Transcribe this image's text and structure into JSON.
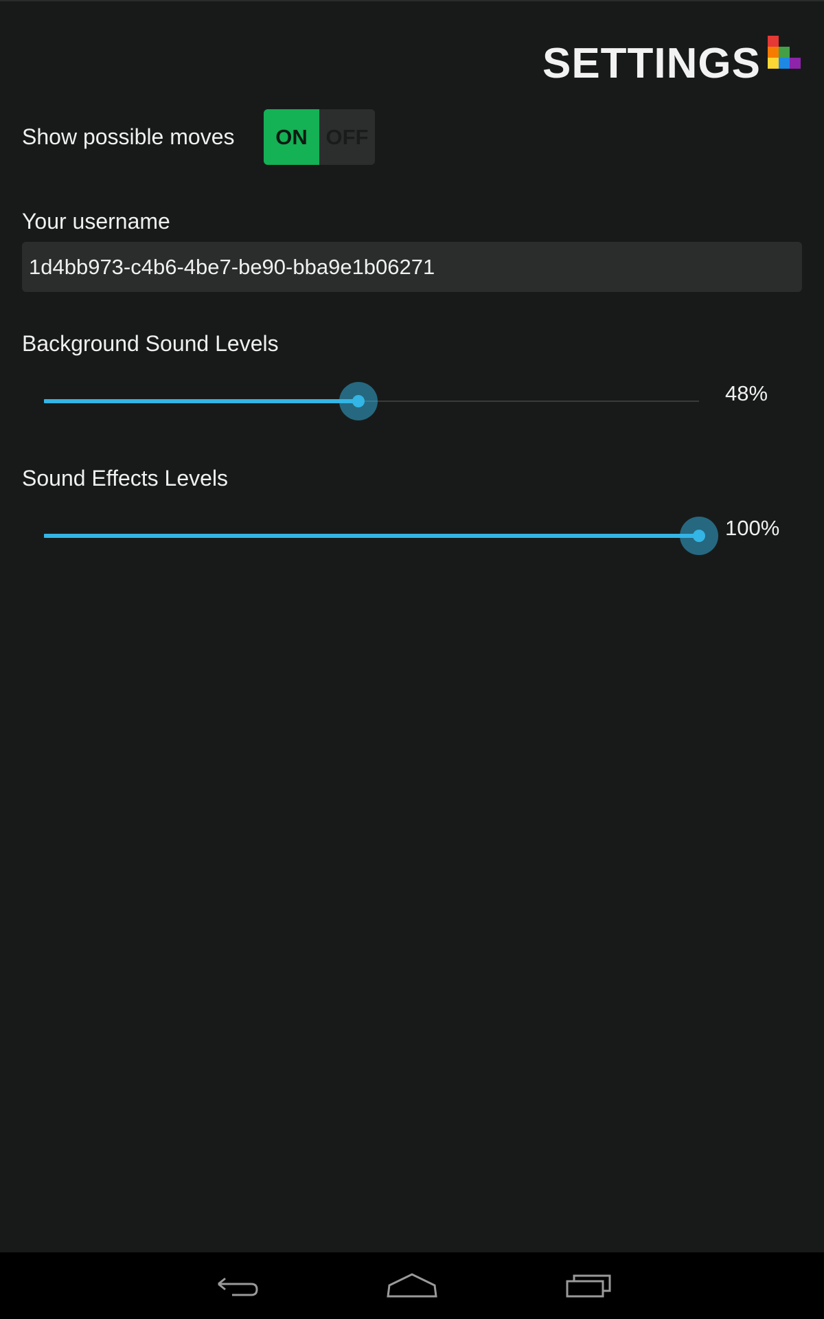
{
  "header": {
    "title": "SETTINGS",
    "logo_colors": [
      "#e53935",
      "#f57c00",
      "#43a047",
      "#fdd835",
      "#1e88e5",
      "#8e24aa"
    ]
  },
  "show_moves": {
    "label": "Show possible moves",
    "on_label": "ON",
    "off_label": "OFF",
    "state": "ON"
  },
  "username": {
    "label": "Your username",
    "value": "1d4bb973-c4b6-4be7-be90-bba9e1b06271"
  },
  "background_sound": {
    "label": "Background Sound Levels",
    "value_text": "48%",
    "level": 0.48
  },
  "sound_effects": {
    "label": "Sound Effects Levels",
    "value_text": "100%",
    "level": 1.0
  },
  "navbar": {
    "icons": [
      "back-icon",
      "home-icon",
      "recent-apps-icon"
    ]
  },
  "colors": {
    "accent": "#33b5e5",
    "toggle_on": "#14b155",
    "background": "#181a1a"
  }
}
